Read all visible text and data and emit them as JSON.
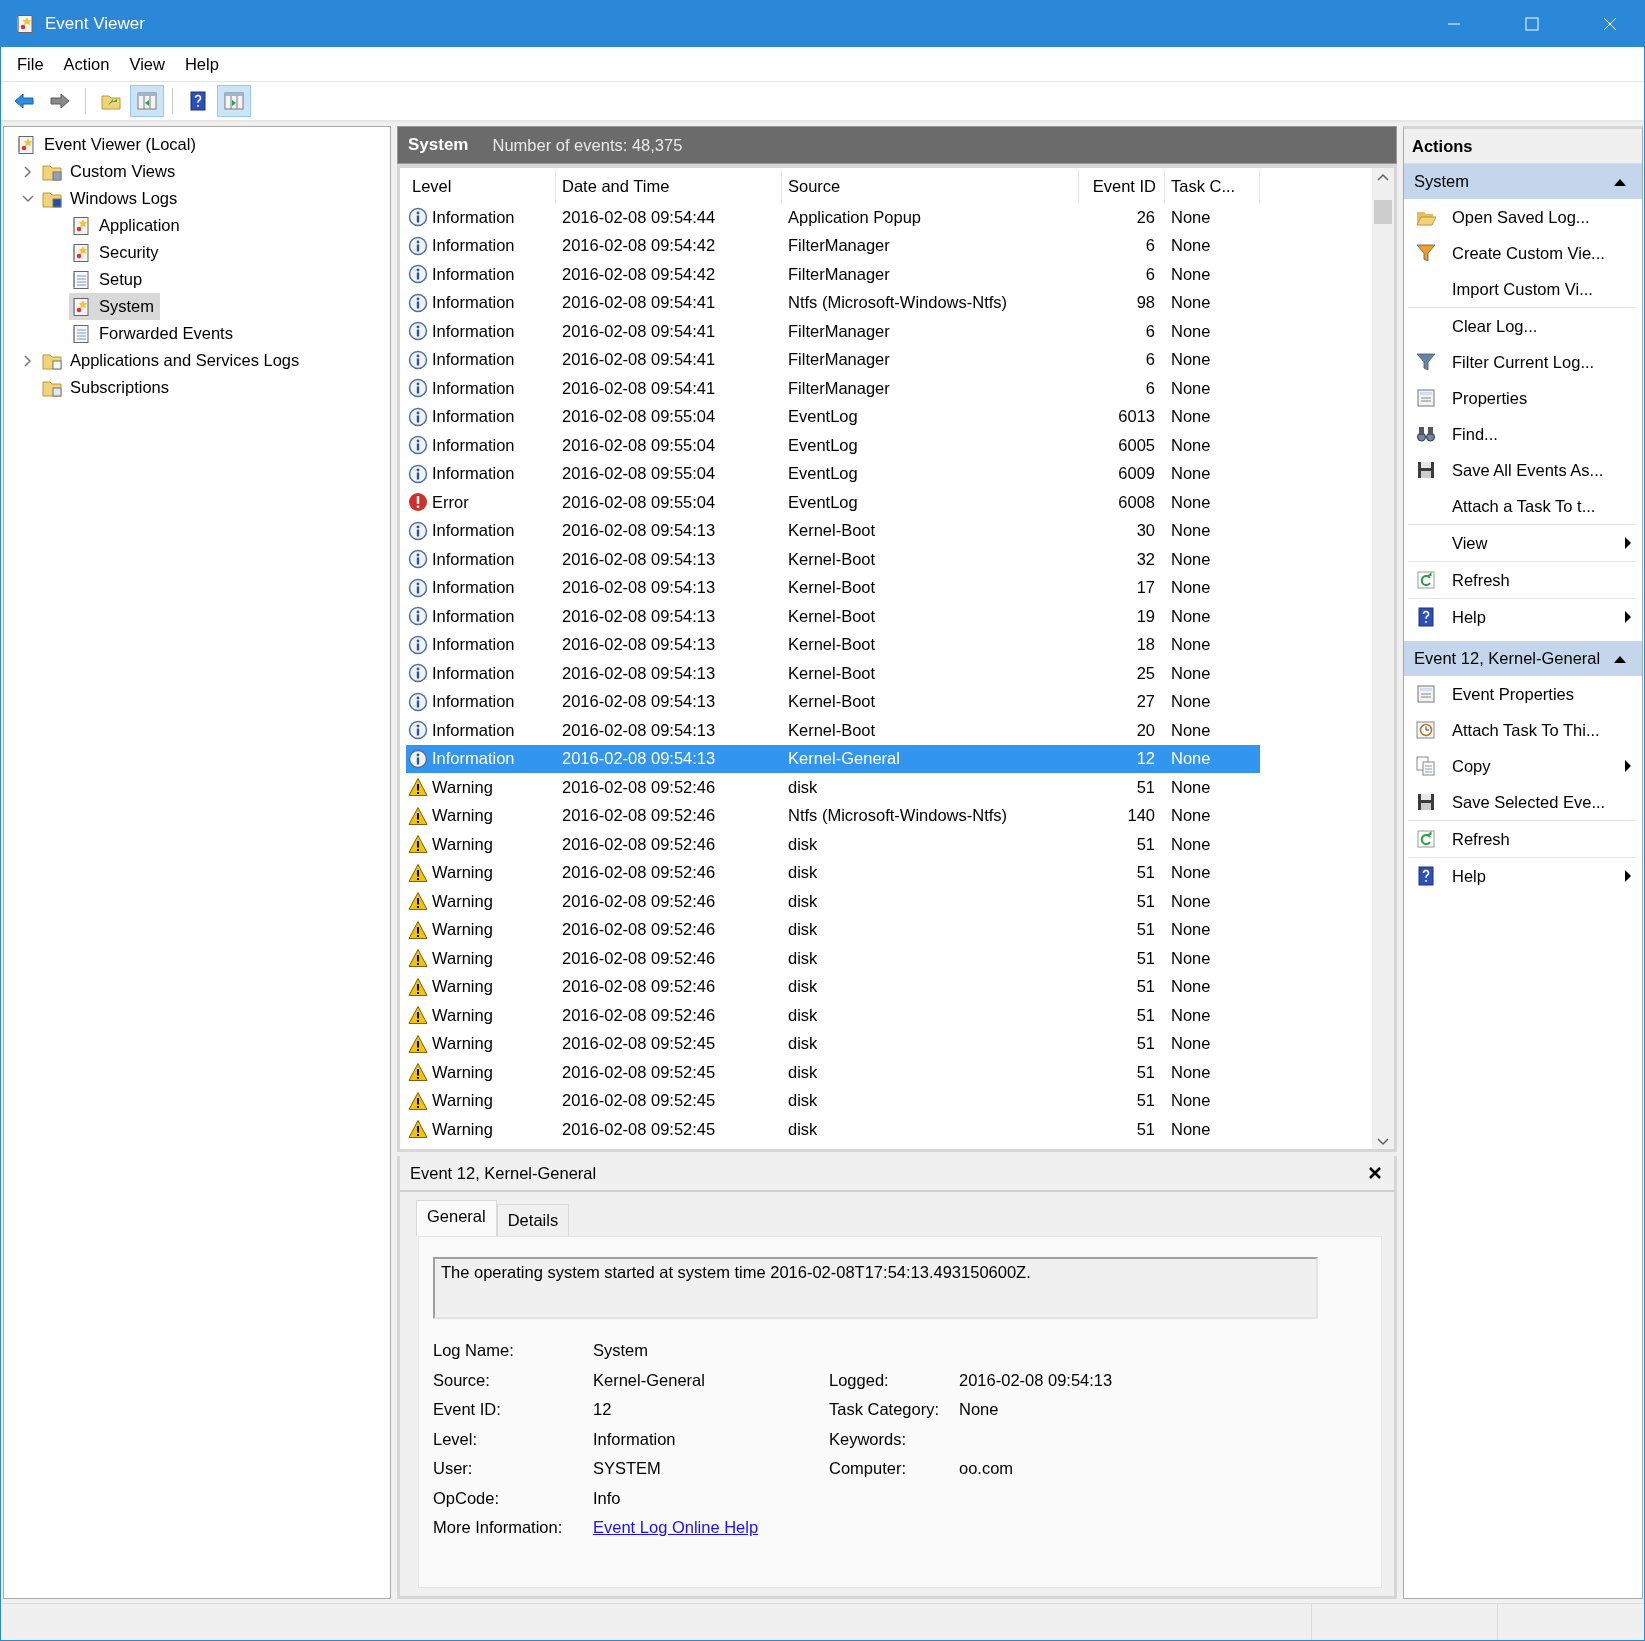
{
  "window": {
    "title": "Event Viewer"
  },
  "menu": [
    "File",
    "Action",
    "View",
    "Help"
  ],
  "toolbar": [
    {
      "kind": "back",
      "pressed": false
    },
    {
      "kind": "forward",
      "pressed": false
    },
    {
      "kind": "folder-up",
      "pressed": false
    },
    {
      "kind": "pane-left",
      "pressed": true
    },
    {
      "kind": "help",
      "pressed": false
    },
    {
      "kind": "pane-right",
      "pressed": true
    }
  ],
  "tree": [
    {
      "label": "Event Viewer (Local)",
      "kind": "log-root",
      "selected": false,
      "children": [
        {
          "label": "Custom Views",
          "kind": "folder-filter",
          "selected": false,
          "expanded": false
        },
        {
          "label": "Windows Logs",
          "kind": "folder-windows",
          "selected": false,
          "expanded": true,
          "children": [
            {
              "label": "Application",
              "kind": "log",
              "selected": false
            },
            {
              "label": "Security",
              "kind": "log",
              "selected": false
            },
            {
              "label": "Setup",
              "kind": "log-plain",
              "selected": false
            },
            {
              "label": "System",
              "kind": "log",
              "selected": true
            },
            {
              "label": "Forwarded Events",
              "kind": "log-plain",
              "selected": false
            }
          ]
        },
        {
          "label": "Applications and Services Logs",
          "kind": "folder",
          "selected": false,
          "expanded": false
        },
        {
          "label": "Subscriptions",
          "kind": "subscription",
          "selected": false
        }
      ]
    }
  ],
  "log_header": {
    "title": "System",
    "count": "Number of events: 48,375"
  },
  "table": {
    "columns": [
      "Level",
      "Date and Time",
      "Source",
      "Event ID",
      "Task C..."
    ],
    "rows": [
      {
        "kind": "information",
        "level": "Information",
        "date": "2016-02-08 09:54:44",
        "source": "Application Popup",
        "event_id": "26",
        "task": "None",
        "selected": false
      },
      {
        "kind": "information",
        "level": "Information",
        "date": "2016-02-08 09:54:42",
        "source": "FilterManager",
        "event_id": "6",
        "task": "None",
        "selected": false
      },
      {
        "kind": "information",
        "level": "Information",
        "date": "2016-02-08 09:54:42",
        "source": "FilterManager",
        "event_id": "6",
        "task": "None",
        "selected": false
      },
      {
        "kind": "information",
        "level": "Information",
        "date": "2016-02-08 09:54:41",
        "source": "Ntfs (Microsoft-Windows-Ntfs)",
        "event_id": "98",
        "task": "None",
        "selected": false
      },
      {
        "kind": "information",
        "level": "Information",
        "date": "2016-02-08 09:54:41",
        "source": "FilterManager",
        "event_id": "6",
        "task": "None",
        "selected": false
      },
      {
        "kind": "information",
        "level": "Information",
        "date": "2016-02-08 09:54:41",
        "source": "FilterManager",
        "event_id": "6",
        "task": "None",
        "selected": false
      },
      {
        "kind": "information",
        "level": "Information",
        "date": "2016-02-08 09:54:41",
        "source": "FilterManager",
        "event_id": "6",
        "task": "None",
        "selected": false
      },
      {
        "kind": "information",
        "level": "Information",
        "date": "2016-02-08 09:55:04",
        "source": "EventLog",
        "event_id": "6013",
        "task": "None",
        "selected": false
      },
      {
        "kind": "information",
        "level": "Information",
        "date": "2016-02-08 09:55:04",
        "source": "EventLog",
        "event_id": "6005",
        "task": "None",
        "selected": false
      },
      {
        "kind": "information",
        "level": "Information",
        "date": "2016-02-08 09:55:04",
        "source": "EventLog",
        "event_id": "6009",
        "task": "None",
        "selected": false
      },
      {
        "kind": "error",
        "level": "Error",
        "date": "2016-02-08 09:55:04",
        "source": "EventLog",
        "event_id": "6008",
        "task": "None",
        "selected": false
      },
      {
        "kind": "information",
        "level": "Information",
        "date": "2016-02-08 09:54:13",
        "source": "Kernel-Boot",
        "event_id": "30",
        "task": "None",
        "selected": false
      },
      {
        "kind": "information",
        "level": "Information",
        "date": "2016-02-08 09:54:13",
        "source": "Kernel-Boot",
        "event_id": "32",
        "task": "None",
        "selected": false
      },
      {
        "kind": "information",
        "level": "Information",
        "date": "2016-02-08 09:54:13",
        "source": "Kernel-Boot",
        "event_id": "17",
        "task": "None",
        "selected": false
      },
      {
        "kind": "information",
        "level": "Information",
        "date": "2016-02-08 09:54:13",
        "source": "Kernel-Boot",
        "event_id": "19",
        "task": "None",
        "selected": false
      },
      {
        "kind": "information",
        "level": "Information",
        "date": "2016-02-08 09:54:13",
        "source": "Kernel-Boot",
        "event_id": "18",
        "task": "None",
        "selected": false
      },
      {
        "kind": "information",
        "level": "Information",
        "date": "2016-02-08 09:54:13",
        "source": "Kernel-Boot",
        "event_id": "25",
        "task": "None",
        "selected": false
      },
      {
        "kind": "information",
        "level": "Information",
        "date": "2016-02-08 09:54:13",
        "source": "Kernel-Boot",
        "event_id": "27",
        "task": "None",
        "selected": false
      },
      {
        "kind": "information",
        "level": "Information",
        "date": "2016-02-08 09:54:13",
        "source": "Kernel-Boot",
        "event_id": "20",
        "task": "None",
        "selected": false
      },
      {
        "kind": "information",
        "level": "Information",
        "date": "2016-02-08 09:54:13",
        "source": "Kernel-General",
        "event_id": "12",
        "task": "None",
        "selected": true
      },
      {
        "kind": "warning",
        "level": "Warning",
        "date": "2016-02-08 09:52:46",
        "source": "disk",
        "event_id": "51",
        "task": "None",
        "selected": false
      },
      {
        "kind": "warning",
        "level": "Warning",
        "date": "2016-02-08 09:52:46",
        "source": "Ntfs (Microsoft-Windows-Ntfs)",
        "event_id": "140",
        "task": "None",
        "selected": false
      },
      {
        "kind": "warning",
        "level": "Warning",
        "date": "2016-02-08 09:52:46",
        "source": "disk",
        "event_id": "51",
        "task": "None",
        "selected": false
      },
      {
        "kind": "warning",
        "level": "Warning",
        "date": "2016-02-08 09:52:46",
        "source": "disk",
        "event_id": "51",
        "task": "None",
        "selected": false
      },
      {
        "kind": "warning",
        "level": "Warning",
        "date": "2016-02-08 09:52:46",
        "source": "disk",
        "event_id": "51",
        "task": "None",
        "selected": false
      },
      {
        "kind": "warning",
        "level": "Warning",
        "date": "2016-02-08 09:52:46",
        "source": "disk",
        "event_id": "51",
        "task": "None",
        "selected": false
      },
      {
        "kind": "warning",
        "level": "Warning",
        "date": "2016-02-08 09:52:46",
        "source": "disk",
        "event_id": "51",
        "task": "None",
        "selected": false
      },
      {
        "kind": "warning",
        "level": "Warning",
        "date": "2016-02-08 09:52:46",
        "source": "disk",
        "event_id": "51",
        "task": "None",
        "selected": false
      },
      {
        "kind": "warning",
        "level": "Warning",
        "date": "2016-02-08 09:52:46",
        "source": "disk",
        "event_id": "51",
        "task": "None",
        "selected": false
      },
      {
        "kind": "warning",
        "level": "Warning",
        "date": "2016-02-08 09:52:45",
        "source": "disk",
        "event_id": "51",
        "task": "None",
        "selected": false
      },
      {
        "kind": "warning",
        "level": "Warning",
        "date": "2016-02-08 09:52:45",
        "source": "disk",
        "event_id": "51",
        "task": "None",
        "selected": false
      },
      {
        "kind": "warning",
        "level": "Warning",
        "date": "2016-02-08 09:52:45",
        "source": "disk",
        "event_id": "51",
        "task": "None",
        "selected": false
      },
      {
        "kind": "warning",
        "level": "Warning",
        "date": "2016-02-08 09:52:45",
        "source": "disk",
        "event_id": "51",
        "task": "None",
        "selected": false
      }
    ]
  },
  "details": {
    "title": "Event 12, Kernel-General",
    "tabs": [
      {
        "label": "General",
        "selected": true
      },
      {
        "label": "Details",
        "selected": false
      }
    ],
    "message": "The operating system started at system time 2016-02-08T17:54:13.493150600Z.",
    "fields": [
      [
        {
          "label": "Log Name:",
          "value": "System"
        }
      ],
      [
        {
          "label": "Source:",
          "value": "Kernel-General"
        },
        {
          "label": "Logged:",
          "value": "2016-02-08 09:54:13"
        }
      ],
      [
        {
          "label": "Event ID:",
          "value": "12"
        },
        {
          "label": "Task Category:",
          "value": "None"
        }
      ],
      [
        {
          "label": "Level:",
          "value": "Information"
        },
        {
          "label": "Keywords:"
        }
      ],
      [
        {
          "label": "User:",
          "value": "SYSTEM"
        },
        {
          "label": "Computer:",
          "value": "oo.com"
        }
      ],
      [
        {
          "label": "OpCode:",
          "value": "Info"
        }
      ],
      [
        {
          "label": "More Information:",
          "value": "Event Log Online Help",
          "kind": "link"
        }
      ]
    ]
  },
  "actions": {
    "title": "Actions",
    "sections": [
      {
        "title": "System",
        "expanded": true,
        "groups": [
          [
            {
              "label": "Open Saved Log...",
              "kind": "open-folder",
              "submenu": false
            },
            {
              "label": "Create Custom Vie...",
              "kind": "funnel-orange",
              "submenu": false
            },
            {
              "label": "Import Custom Vi...",
              "kind": "none",
              "submenu": false
            }
          ],
          [
            {
              "label": "Clear Log...",
              "kind": "none",
              "submenu": false
            },
            {
              "label": "Filter Current Log...",
              "kind": "funnel",
              "submenu": false
            },
            {
              "label": "Properties",
              "kind": "properties",
              "submenu": false
            },
            {
              "label": "Find...",
              "kind": "binoculars",
              "submenu": false
            },
            {
              "label": "Save All Events As...",
              "kind": "floppy",
              "submenu": false
            },
            {
              "label": "Attach a Task To t...",
              "kind": "none",
              "submenu": false
            }
          ],
          [
            {
              "label": "View",
              "kind": "none",
              "submenu": true
            }
          ],
          [
            {
              "label": "Refresh",
              "kind": "refresh",
              "submenu": false
            }
          ],
          [
            {
              "label": "Help",
              "kind": "help",
              "submenu": true
            }
          ]
        ]
      },
      {
        "title": "Event 12, Kernel-General",
        "expanded": true,
        "groups": [
          [
            {
              "label": "Event Properties",
              "kind": "properties",
              "submenu": false
            },
            {
              "label": "Attach Task To Thi...",
              "kind": "clock",
              "submenu": false
            },
            {
              "label": "Copy",
              "kind": "copy",
              "submenu": true
            },
            {
              "label": "Save Selected Eve...",
              "kind": "floppy",
              "submenu": false
            }
          ],
          [
            {
              "label": "Refresh",
              "kind": "refresh",
              "submenu": false
            }
          ],
          [
            {
              "label": "Help",
              "kind": "help",
              "submenu": true
            }
          ]
        ]
      }
    ]
  }
}
